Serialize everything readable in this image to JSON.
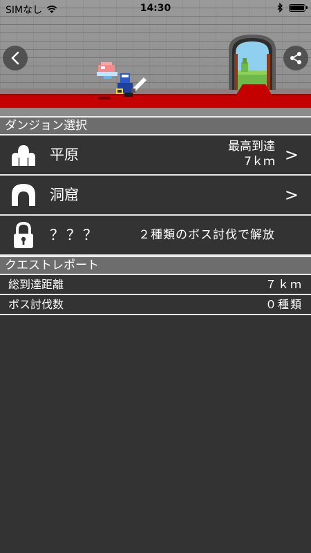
{
  "status_bar": {
    "carrier": "SIMなし",
    "time": "14:30",
    "battery_level": 1.0
  },
  "banner": {
    "back_icon": "<",
    "share_icon": "share-icon"
  },
  "dungeon_section": {
    "title": "ダンジョン選択",
    "rows": [
      {
        "name": "平原",
        "best_label": "最高到達",
        "best_value": "7ｋｍ",
        "chevron": ">",
        "icon": "hills-icon"
      },
      {
        "name": "洞窟",
        "chevron": ">",
        "icon": "cave-icon"
      },
      {
        "name": "？？？",
        "unlock_text": "２種類のボス討伐で解放",
        "icon": "lock-icon"
      }
    ]
  },
  "report_section": {
    "title": "クエストレポート",
    "rows": [
      {
        "label": "総到達距離",
        "value": "７ｋｍ"
      },
      {
        "label": "ボス討伐数",
        "value": "０種類"
      }
    ]
  },
  "colors": {
    "background": "#333333",
    "header": "#6d6d6d",
    "carpet": "#c40000",
    "wall": "#8f8f8f"
  }
}
